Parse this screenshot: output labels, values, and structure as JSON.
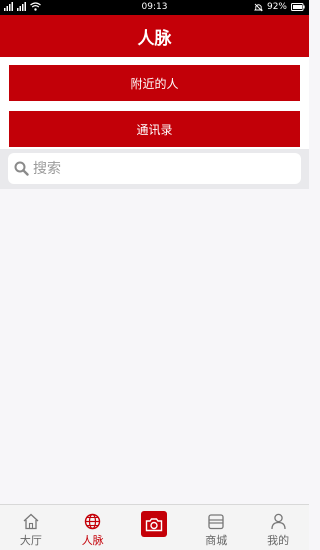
{
  "status_bar": {
    "time": "09:13",
    "battery": "92%",
    "icons": [
      "signal-icon",
      "signal-icon",
      "wifi-icon",
      "alarm-icon",
      "battery-icon"
    ]
  },
  "header": {
    "title": "人脉"
  },
  "buttons": {
    "nearby_label": "附近的人",
    "contacts_label": "通讯录"
  },
  "search": {
    "placeholder": "搜索",
    "value": ""
  },
  "tabs": [
    {
      "label": "大厅",
      "icon": "home-icon",
      "active": false
    },
    {
      "label": "人脉",
      "icon": "globe-icon",
      "active": true
    },
    {
      "label": "",
      "icon": "camera-icon",
      "active": false
    },
    {
      "label": "商城",
      "icon": "store-icon",
      "active": false
    },
    {
      "label": "我的",
      "icon": "user-icon",
      "active": false
    }
  ],
  "colors": {
    "brand": "#c40008",
    "background": "#f7f6f9"
  }
}
